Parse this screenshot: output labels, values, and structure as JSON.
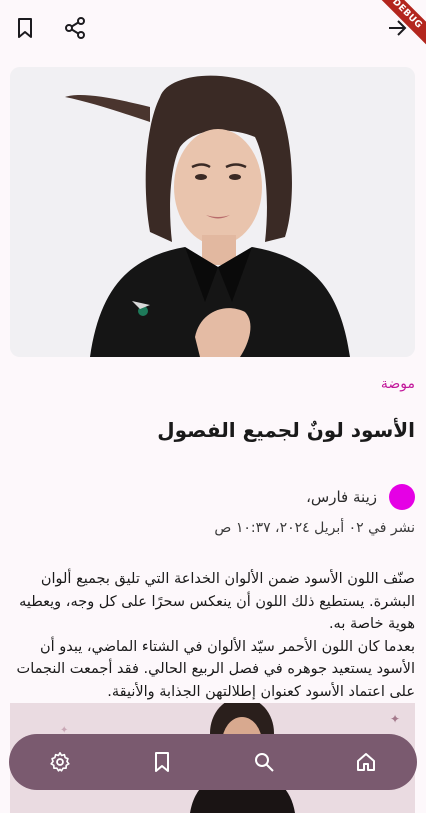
{
  "app": {
    "debug_label": "DEBUG"
  },
  "toolbar": {
    "icons": [
      "bookmark-icon",
      "share-icon",
      "arrow-forward-icon"
    ]
  },
  "article": {
    "category": "موضة",
    "title": "الأسود لونٌ لجميع الفصول",
    "author": "زينة فارس،",
    "published": "نشر في ٠٢ أبريل ٢٠٢٤، ١٠:٣٧ ص",
    "paragraphs": [
      "صنّف اللون الأسود ضمن الألوان الخداعة التي تليق بجميع ألوان البشرة. يستطيع ذلك اللون أن ينعكس سحرًا على كل وجه، ويعطيه هوية خاصة به.",
      "بعدما كان اللون الأحمر سيّد الألوان في الشتاء الماضي، يبدو أن الأسود يستعيد جوهره في فصل الربيع الحالي. فقد أجمعت النجمات على اعتماد الأسود كعنوان إطلالتهن الجذابة والأنيقة."
    ]
  },
  "colors": {
    "accent": "#c2189b",
    "avatar": "#e500e5",
    "nav_bg": "#7a5a6f",
    "background": "#fdf8fb"
  },
  "bottom_nav": {
    "items": [
      "settings-icon",
      "bookmark-icon",
      "search-icon",
      "home-icon"
    ]
  }
}
